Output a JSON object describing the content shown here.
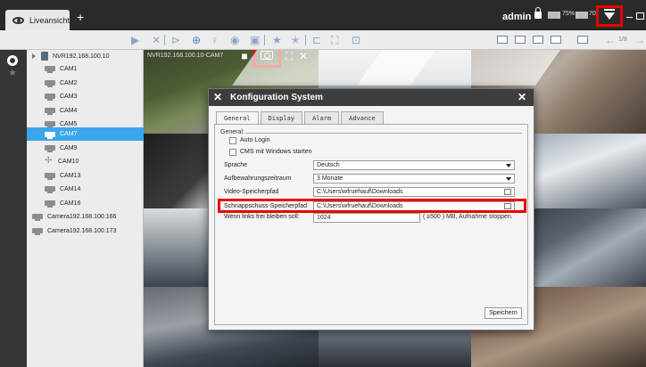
{
  "titlebar": {
    "tab_label": "Liveansicht",
    "new_tab": "+",
    "user": "admin",
    "cpu_label": "75%",
    "mem_label": "70"
  },
  "toolbar": {
    "page": "1/8"
  },
  "tree": {
    "nvr_label": "NVR192.168.100.10",
    "cameras": [
      "CAM1",
      "CAM2",
      "CAM3",
      "CAM4",
      "CAM5",
      "CAM7",
      "CAM9",
      "CAM10",
      "CAM13",
      "CAM14",
      "CAM16"
    ],
    "selected": "CAM7",
    "extra_devices": [
      "Camera192.168.100.166",
      "Camera192.168.100.173"
    ]
  },
  "video": {
    "active_label": "NVR192.168.100.10-CAM7"
  },
  "dialog": {
    "title": "Konfiguration System",
    "tabs": [
      "General",
      "Display",
      "Alarm",
      "Advance"
    ],
    "group_label": "General:",
    "auto_login": "Auto Login",
    "cms_start": "CMS mit Windows starten",
    "language_label": "Sprache",
    "language_value": "Deutsch",
    "retention_label": "Aufbewahrungszeitraum",
    "retention_value": "3 Monate",
    "video_path_label": "Video-Speicherpfad",
    "video_path_value": "C:\\Users\\wfruehauf\\Downloads",
    "snapshot_path_label": "Schnappschuss-Speicherpfad",
    "snapshot_path_value": "C:\\Users\\wfruehauf\\Downloads",
    "free_space_label": "Wenn links frei bleiben soll:",
    "free_space_value": "1024",
    "free_space_note": "( ≥500 ) MB, Aufnahme stoppen.",
    "save_label": "Speichern"
  },
  "colors": {
    "accent": "#3aa6eb",
    "highlight": "#e00000",
    "dialog_header": "#3d3d3d"
  }
}
